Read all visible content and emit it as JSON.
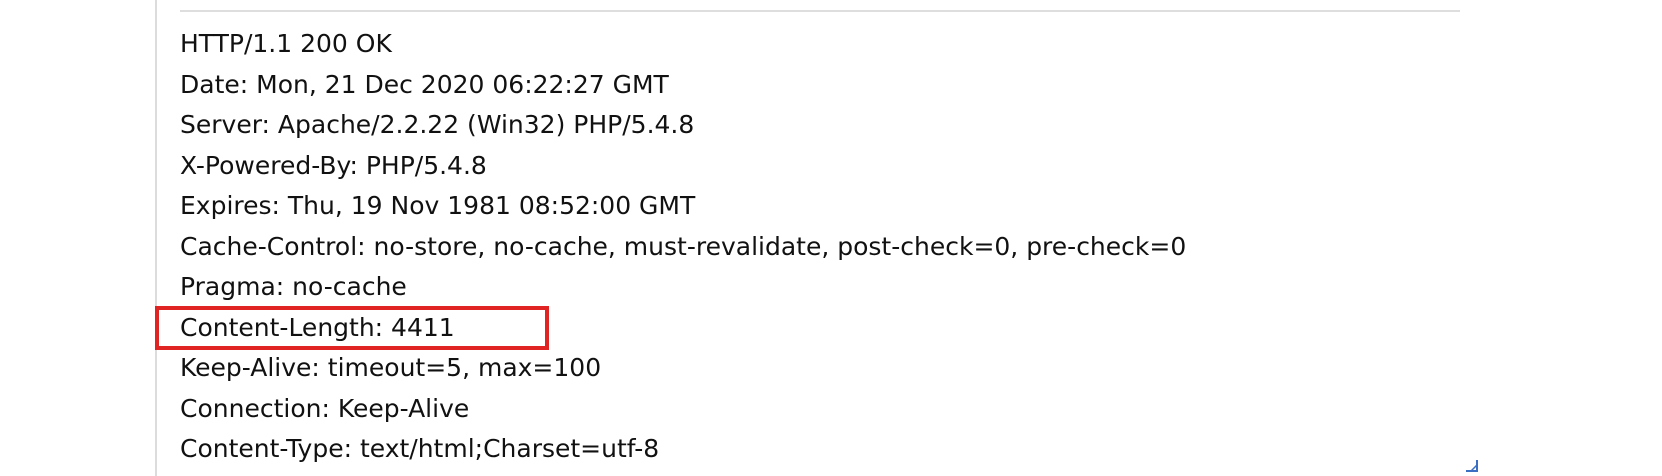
{
  "response": {
    "status_line": "HTTP/1.1 200 OK",
    "headers": [
      "Date: Mon, 21 Dec 2020 06:22:27 GMT",
      "Server: Apache/2.2.22 (Win32) PHP/5.4.8",
      "X-Powered-By: PHP/5.4.8",
      "Expires: Thu, 19 Nov 1981 08:52:00 GMT",
      "Cache-Control: no-store, no-cache, must-revalidate, post-check=0, pre-check=0",
      "Pragma: no-cache",
      "Content-Length: 4411",
      "Keep-Alive: timeout=5, max=100",
      "Connection: Keep-Alive",
      "Content-Type: text/html;Charset=utf-8"
    ]
  },
  "highlight": {
    "color": "#e02424"
  },
  "icons": {
    "resize_grip": "resize-grip-icon"
  }
}
